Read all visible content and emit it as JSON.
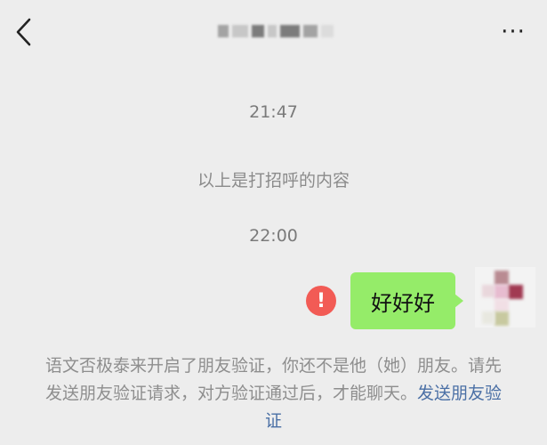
{
  "header": {
    "back_icon": "chevron-left-icon",
    "more_label": "···"
  },
  "chat": {
    "time_1": "21:47",
    "greeting_note": "以上是打招呼的内容",
    "time_2": "22:00",
    "message": {
      "text": "好好好",
      "status_icon": "error-icon",
      "status_symbol": "!"
    },
    "notice_text": "语文否极泰来开启了朋友验证，你还不是他（她）朋友。请先发送朋友验证请求，对方验证通过后，才能聊天。",
    "notice_link": "发送朋友验证"
  },
  "colors": {
    "background": "#ededed",
    "bubble": "#95ec69",
    "error": "#f25b55",
    "link": "#4a6fa5"
  }
}
